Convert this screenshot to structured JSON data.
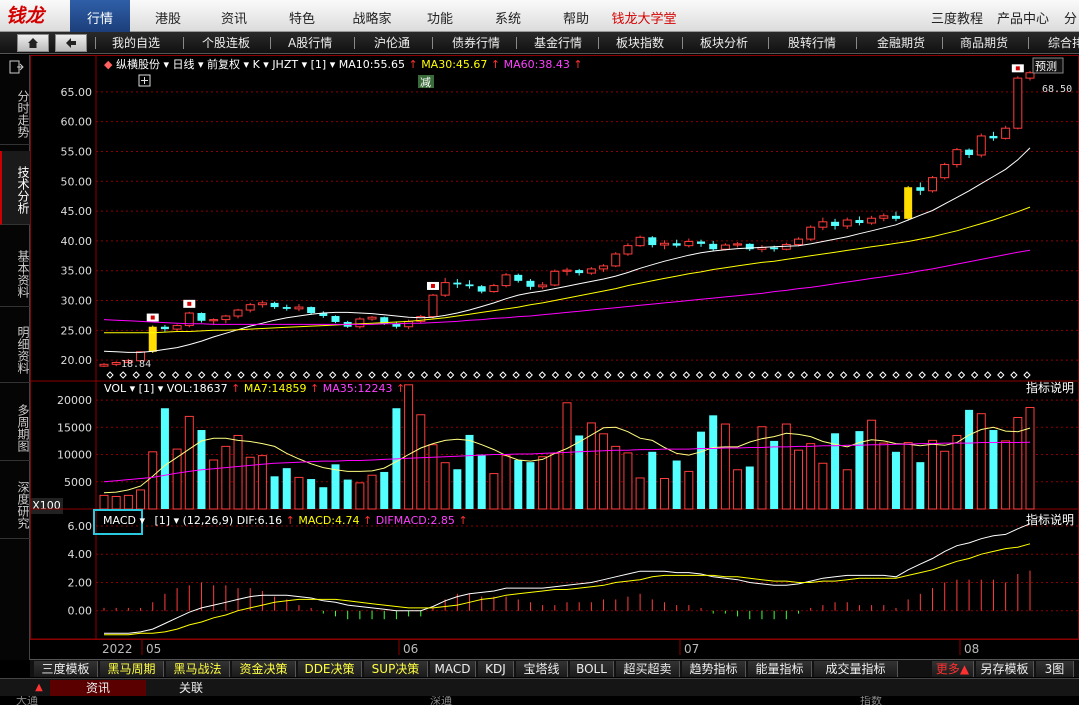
{
  "logo": "钱龙",
  "top_menu": {
    "active": "行情",
    "items": [
      "港股",
      "资讯",
      "特色",
      "战略家",
      "功能",
      "系统",
      "帮助"
    ],
    "highlight": "钱龙大学堂",
    "right_items": [
      "三度教程",
      "产品中心",
      "分"
    ]
  },
  "nav": {
    "home_icon": "home-icon",
    "back_icon": "back-arrow-icon",
    "items": [
      "我的自选",
      "个股连板",
      "A股行情",
      "沪伦通",
      "债券行情",
      "基金行情",
      "板块指数",
      "板块分析",
      "股转行情",
      "金融期货",
      "商品期货",
      "综合排"
    ]
  },
  "left_tabs": [
    "分时走势",
    "技术分析",
    "基本资料",
    "明细资料",
    "多周期图",
    "深度研究"
  ],
  "left_active": "技术分析",
  "x100": "X100",
  "chart_header": {
    "stock": "纵横股份",
    "period": "日线",
    "adjust": "前复权",
    "type": "K",
    "indicator": "JHZT",
    "param": "[1]",
    "ma10": "MA10:55.65",
    "ma30": "MA30:45.67",
    "ma60": "MA60:38.43",
    "jian": "减",
    "predict": "预测",
    "high_label": "68.50",
    "low_label": "18.84"
  },
  "vol_header": {
    "name": "VOL",
    "param": "[1]",
    "vol": "VOL:18637",
    "ma7": "MA7:14859",
    "ma35": "MA35:12243",
    "help": "指标说明"
  },
  "macd_header": {
    "name": "MACD",
    "param": "[1]",
    "args": "(12,26,9)",
    "dif": "DIF:6.16",
    "macd": "MACD:4.74",
    "difmacd": "DIFMACD:2.85",
    "help": "指标说明"
  },
  "x_labels": [
    "2022",
    "05",
    "06",
    "07",
    "08"
  ],
  "bottom_tabs": [
    "三度模板",
    "黑马周期",
    "黑马战法",
    "资金决策",
    "DDE决策",
    "SUP决策",
    "MACD",
    "KDJ",
    "宝塔线",
    "BOLL",
    "超买超卖",
    "趋势指标",
    "能量指标",
    "成交量指标"
  ],
  "bottom_tabs_highlight": [
    "黑马周期",
    "黑马战法",
    "资金决策",
    "DDE决策",
    "SUP决策"
  ],
  "bottom_more": "更多▲",
  "bottom_template": "另存模板",
  "bottom_view": "3图",
  "bottom_bar2": [
    "资讯",
    "关联"
  ],
  "bottom_bar3": [
    "大通",
    "深通",
    "指数"
  ],
  "colors": {
    "up": "#ff3c3c",
    "down": "#54ffff",
    "ma10": "#ffffff",
    "ma30": "#ffff00",
    "ma60": "#ff00ff",
    "grid": "#8b0000"
  },
  "chart_data": [
    {
      "type": "candlestick",
      "title": "纵横股份",
      "yticks": [
        20,
        25,
        30,
        35,
        40,
        45,
        50,
        55,
        60,
        65
      ],
      "ylim": [
        16.5,
        69.5
      ],
      "ytick_labels": [
        "20.00",
        "25.00",
        "30.00",
        "35.00",
        "40.00",
        "45.00",
        "50.00",
        "55.00",
        "60.00",
        "65.00"
      ],
      "candles": [
        [
          19.0,
          19.5,
          18.84,
          19.3
        ],
        [
          19.3,
          19.8,
          19.0,
          19.6
        ],
        [
          19.6,
          20.2,
          19.4,
          19.9
        ],
        [
          19.9,
          21.5,
          19.7,
          21.4
        ],
        [
          21.4,
          25.8,
          21.2,
          25.6
        ],
        [
          25.6,
          25.9,
          24.8,
          25.2
        ],
        [
          25.2,
          26.0,
          24.9,
          25.8
        ],
        [
          25.8,
          28.1,
          25.5,
          27.9
        ],
        [
          27.9,
          28.0,
          26.3,
          26.6
        ],
        [
          26.6,
          27.0,
          25.9,
          26.8
        ],
        [
          26.8,
          27.6,
          26.2,
          27.4
        ],
        [
          27.4,
          28.6,
          27.0,
          28.4
        ],
        [
          28.4,
          29.6,
          28.0,
          29.3
        ],
        [
          29.3,
          29.9,
          28.8,
          29.6
        ],
        [
          29.6,
          29.8,
          28.6,
          28.9
        ],
        [
          28.9,
          29.3,
          28.3,
          28.6
        ],
        [
          28.6,
          29.4,
          28.2,
          28.9
        ],
        [
          28.9,
          29.0,
          27.6,
          27.9
        ],
        [
          27.9,
          28.2,
          27.1,
          27.4
        ],
        [
          27.4,
          27.5,
          26.2,
          26.4
        ],
        [
          26.4,
          26.6,
          25.4,
          25.6
        ],
        [
          25.6,
          27.2,
          25.3,
          26.9
        ],
        [
          26.9,
          27.4,
          26.6,
          27.2
        ],
        [
          27.2,
          27.3,
          25.9,
          26.1
        ],
        [
          26.1,
          26.5,
          25.3,
          25.6
        ],
        [
          25.6,
          26.8,
          25.2,
          26.5
        ],
        [
          26.5,
          27.6,
          26.2,
          27.3
        ],
        [
          27.3,
          31.1,
          27.0,
          30.9
        ],
        [
          30.9,
          33.8,
          30.6,
          33.0
        ],
        [
          33.0,
          33.6,
          32.1,
          32.7
        ],
        [
          32.7,
          33.4,
          32.0,
          32.4
        ],
        [
          32.4,
          32.6,
          31.2,
          31.5
        ],
        [
          31.5,
          32.8,
          31.3,
          32.5
        ],
        [
          32.5,
          34.6,
          32.2,
          34.3
        ],
        [
          34.3,
          34.5,
          33.0,
          33.3
        ],
        [
          33.3,
          33.6,
          31.8,
          32.3
        ],
        [
          32.3,
          33.1,
          31.9,
          32.6
        ],
        [
          32.6,
          35.2,
          32.4,
          34.9
        ],
        [
          34.9,
          35.5,
          34.2,
          35.1
        ],
        [
          35.1,
          35.3,
          34.2,
          34.6
        ],
        [
          34.6,
          35.6,
          34.3,
          35.3
        ],
        [
          35.3,
          36.1,
          34.8,
          35.8
        ],
        [
          35.8,
          38.1,
          35.6,
          37.8
        ],
        [
          37.8,
          39.6,
          37.5,
          39.2
        ],
        [
          39.2,
          40.9,
          39.0,
          40.6
        ],
        [
          40.6,
          40.8,
          38.9,
          39.3
        ],
        [
          39.3,
          40.1,
          38.6,
          39.6
        ],
        [
          39.6,
          40.2,
          38.9,
          39.2
        ],
        [
          39.2,
          40.4,
          38.9,
          39.9
        ],
        [
          39.9,
          40.2,
          39.0,
          39.5
        ],
        [
          39.5,
          40.0,
          38.3,
          38.6
        ],
        [
          38.6,
          39.6,
          38.4,
          39.3
        ],
        [
          39.3,
          39.8,
          38.9,
          39.5
        ],
        [
          39.5,
          39.6,
          38.3,
          38.6
        ],
        [
          38.6,
          39.3,
          38.1,
          38.9
        ],
        [
          38.9,
          39.2,
          38.2,
          38.6
        ],
        [
          38.6,
          39.7,
          38.4,
          39.4
        ],
        [
          39.4,
          40.6,
          39.1,
          40.3
        ],
        [
          40.3,
          42.6,
          40.0,
          42.3
        ],
        [
          42.3,
          43.9,
          41.8,
          43.2
        ],
        [
          43.2,
          43.7,
          41.9,
          42.5
        ],
        [
          42.5,
          43.9,
          42.0,
          43.5
        ],
        [
          43.5,
          44.1,
          42.6,
          43.0
        ],
        [
          43.0,
          44.2,
          42.7,
          43.8
        ],
        [
          43.8,
          44.6,
          43.3,
          44.2
        ],
        [
          44.2,
          44.9,
          43.3,
          43.7
        ],
        [
          43.7,
          49.2,
          43.4,
          49.0
        ],
        [
          49.0,
          49.8,
          47.7,
          48.4
        ],
        [
          48.4,
          50.9,
          48.1,
          50.6
        ],
        [
          50.6,
          53.1,
          50.3,
          52.8
        ],
        [
          52.8,
          55.6,
          52.3,
          55.3
        ],
        [
          55.3,
          55.5,
          53.9,
          54.4
        ],
        [
          54.4,
          58.0,
          54.0,
          57.6
        ],
        [
          57.6,
          58.3,
          56.8,
          57.2
        ],
        [
          57.2,
          59.3,
          57.0,
          58.9
        ],
        [
          58.9,
          67.6,
          58.7,
          67.3
        ],
        [
          67.3,
          68.5,
          66.9,
          68.2
        ]
      ],
      "ma10": [
        21.5,
        21.4,
        21.3,
        21.3,
        21.5,
        21.8,
        22.1,
        22.6,
        23.2,
        23.9,
        24.5,
        25.1,
        25.7,
        26.2,
        26.7,
        27.1,
        27.4,
        27.7,
        27.9,
        28.0,
        28.0,
        27.9,
        27.8,
        27.6,
        27.4,
        27.2,
        27.1,
        27.2,
        27.5,
        27.9,
        28.4,
        29.0,
        29.6,
        30.3,
        30.9,
        31.3,
        31.6,
        32.0,
        32.4,
        32.8,
        33.2,
        33.6,
        34.1,
        34.7,
        35.4,
        36.0,
        36.6,
        37.1,
        37.6,
        38.0,
        38.3,
        38.5,
        38.7,
        38.8,
        38.9,
        39.0,
        39.1,
        39.2,
        39.5,
        39.9,
        40.3,
        40.7,
        41.2,
        41.7,
        42.2,
        42.7,
        43.5,
        44.3,
        45.1,
        46.2,
        47.3,
        48.4,
        49.6,
        50.8,
        52.0,
        53.6,
        55.6
      ],
      "ma30": [
        24.6,
        24.6,
        24.6,
        24.6,
        24.6,
        24.7,
        24.8,
        24.8,
        24.9,
        25.0,
        25.0,
        25.1,
        25.2,
        25.3,
        25.4,
        25.5,
        25.6,
        25.7,
        25.8,
        25.9,
        26.0,
        26.1,
        26.2,
        26.3,
        26.4,
        26.5,
        26.7,
        26.9,
        27.1,
        27.4,
        27.7,
        28.0,
        28.3,
        28.6,
        28.9,
        29.3,
        29.6,
        30.0,
        30.4,
        30.8,
        31.2,
        31.6,
        32.0,
        32.5,
        32.9,
        33.3,
        33.7,
        34.1,
        34.5,
        34.8,
        35.2,
        35.5,
        35.8,
        36.1,
        36.4,
        36.6,
        36.9,
        37.2,
        37.5,
        37.8,
        38.1,
        38.4,
        38.7,
        39.0,
        39.3,
        39.6,
        39.9,
        40.3,
        40.7,
        41.2,
        41.7,
        42.3,
        42.9,
        43.5,
        44.2,
        44.9,
        45.67
      ],
      "ma60": [
        26.8,
        26.7,
        26.6,
        26.5,
        26.4,
        26.3,
        26.2,
        26.1,
        26.1,
        26.0,
        26.0,
        26.0,
        26.0,
        26.0,
        26.0,
        26.0,
        26.0,
        26.0,
        26.0,
        26.0,
        26.0,
        26.0,
        26.0,
        26.1,
        26.1,
        26.2,
        26.2,
        26.3,
        26.4,
        26.5,
        26.7,
        26.8,
        27.0,
        27.1,
        27.3,
        27.4,
        27.6,
        27.8,
        28.0,
        28.2,
        28.4,
        28.6,
        28.8,
        29.0,
        29.2,
        29.4,
        29.6,
        29.8,
        30.0,
        30.2,
        30.4,
        30.6,
        30.8,
        31.0,
        31.2,
        31.5,
        31.7,
        32.0,
        32.2,
        32.5,
        32.8,
        33.1,
        33.4,
        33.7,
        34.0,
        34.3,
        34.6,
        35.0,
        35.3,
        35.7,
        36.1,
        36.5,
        36.9,
        37.3,
        37.7,
        38.1,
        38.43
      ],
      "yellow_signals": [
        4,
        66
      ]
    },
    {
      "type": "bar",
      "title": "VOL",
      "yticks": [
        5000,
        10000,
        15000,
        20000
      ],
      "ytick_labels": [
        "5000",
        "10000",
        "15000",
        "20000"
      ],
      "ylim": [
        0,
        23500
      ],
      "values": [
        2500,
        2300,
        2500,
        3500,
        10500,
        18500,
        11000,
        17000,
        14500,
        9000,
        11500,
        13500,
        9500,
        9800,
        6000,
        7500,
        5800,
        5500,
        4000,
        8200,
        5400,
        4800,
        6200,
        6800,
        18500,
        22800,
        17300,
        11800,
        8500,
        7300,
        13600,
        10000,
        6500,
        9800,
        9000,
        8600,
        9600,
        10200,
        19500,
        13500,
        15800,
        13800,
        11500,
        10300,
        5700,
        10500,
        5600,
        8900,
        6900,
        14200,
        17200,
        15600,
        7200,
        7800,
        15100,
        12500,
        15600,
        10800,
        12000,
        8400,
        13900,
        7200,
        14300,
        16300,
        12100,
        10500,
        12200,
        8600,
        12600,
        10600,
        13500,
        18200,
        17500,
        14500,
        12500,
        16800,
        18637
      ],
      "ma7": [
        3000,
        3100,
        3500,
        4200,
        6000,
        8000,
        9500,
        11000,
        12500,
        13000,
        13000,
        12600,
        12400,
        12000,
        11500,
        10200,
        9200,
        8300,
        7600,
        7200,
        6900,
        6900,
        7000,
        7500,
        8700,
        10000,
        11200,
        12000,
        12600,
        12800,
        12600,
        11800,
        10900,
        9800,
        9000,
        8800,
        9100,
        10200,
        11100,
        12300,
        13600,
        14900,
        15000,
        14200,
        13000,
        12600,
        11300,
        10200,
        9900,
        10500,
        11300,
        11400,
        11400,
        12300,
        12900,
        13300,
        13900,
        13700,
        13300,
        12400,
        11900,
        11400,
        12200,
        12700,
        12500,
        12000,
        11900,
        11600,
        11900,
        11700,
        12200,
        13600,
        14600,
        15000,
        14300,
        14200,
        14859
      ],
      "ma35": [
        5000,
        5200,
        5400,
        5600,
        5800,
        6200,
        6600,
        6900,
        7200,
        7400,
        7600,
        7800,
        8000,
        8200,
        8400,
        8500,
        8600,
        8700,
        8800,
        8800,
        8900,
        8900,
        9000,
        9100,
        9200,
        9300,
        9400,
        9500,
        9600,
        9700,
        9800,
        9900,
        10000,
        10000,
        10100,
        10100,
        10200,
        10300,
        10400,
        10500,
        10600,
        10700,
        10800,
        10800,
        10900,
        10900,
        11000,
        11000,
        11000,
        11100,
        11100,
        11200,
        11200,
        11300,
        11300,
        11400,
        11400,
        11500,
        11500,
        11600,
        11600,
        11700,
        11700,
        11800,
        11800,
        11900,
        11900,
        12000,
        12000,
        12100,
        12100,
        12100,
        12200,
        12200,
        12200,
        12200,
        12243
      ]
    },
    {
      "type": "line",
      "title": "MACD",
      "yticks": [
        0,
        2,
        4,
        6
      ],
      "ytick_labels": [
        "0.00",
        "2.00",
        "4.00",
        "6.00"
      ],
      "ylim": [
        -2,
        7.2
      ],
      "dif": [
        -1.6,
        -1.6,
        -1.6,
        -1.5,
        -1.3,
        -0.9,
        -0.5,
        -0.1,
        0.2,
        0.4,
        0.6,
        0.8,
        1.0,
        1.1,
        1.1,
        1.1,
        1.0,
        0.9,
        0.7,
        0.6,
        0.4,
        0.3,
        0.2,
        0.1,
        0.0,
        0.0,
        0.0,
        0.3,
        0.7,
        1.0,
        1.2,
        1.3,
        1.4,
        1.6,
        1.6,
        1.6,
        1.6,
        1.7,
        1.8,
        1.9,
        2.0,
        2.2,
        2.4,
        2.6,
        2.8,
        2.8,
        2.8,
        2.7,
        2.7,
        2.6,
        2.4,
        2.3,
        2.2,
        2.0,
        1.9,
        1.8,
        1.8,
        1.9,
        2.1,
        2.3,
        2.4,
        2.5,
        2.5,
        2.5,
        2.5,
        2.4,
        2.9,
        3.3,
        3.7,
        4.2,
        4.6,
        4.8,
        5.1,
        5.3,
        5.4,
        5.8,
        6.16
      ],
      "dea": [
        -1.7,
        -1.7,
        -1.7,
        -1.6,
        -1.6,
        -1.5,
        -1.3,
        -1.0,
        -0.8,
        -0.5,
        -0.3,
        0.0,
        0.2,
        0.4,
        0.6,
        0.7,
        0.8,
        0.8,
        0.8,
        0.8,
        0.7,
        0.6,
        0.5,
        0.4,
        0.3,
        0.2,
        0.2,
        0.2,
        0.3,
        0.4,
        0.6,
        0.8,
        0.9,
        1.1,
        1.2,
        1.3,
        1.4,
        1.5,
        1.5,
        1.6,
        1.7,
        1.8,
        2.0,
        2.1,
        2.2,
        2.4,
        2.5,
        2.5,
        2.5,
        2.5,
        2.5,
        2.4,
        2.4,
        2.3,
        2.2,
        2.1,
        2.1,
        2.0,
        2.0,
        2.1,
        2.1,
        2.2,
        2.3,
        2.3,
        2.3,
        2.3,
        2.5,
        2.7,
        2.9,
        3.2,
        3.5,
        3.7,
        4.0,
        4.2,
        4.4,
        4.5,
        4.74
      ],
      "histogram_colors": "red positive / cyan negative"
    }
  ]
}
